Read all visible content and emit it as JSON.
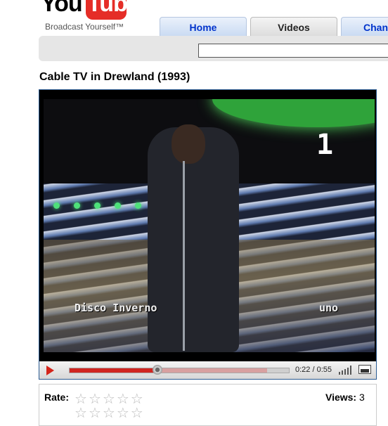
{
  "header": {
    "logo_you": "You",
    "logo_tube": "Tube",
    "tagline": "Broadcast Yourself™"
  },
  "nav": {
    "tabs": [
      {
        "label": "Home"
      },
      {
        "label": "Videos"
      },
      {
        "label": "Chann"
      }
    ]
  },
  "search": {
    "value": ""
  },
  "video": {
    "title": "Cable TV in Drewland (1993)",
    "osd_channel": "1",
    "osd_caption": "Disco Inverno",
    "osd_logo": "uno"
  },
  "player": {
    "time": "0:22 / 0:55",
    "played_fraction": 0.4,
    "loaded_fraction": 0.9
  },
  "rating": {
    "rate_label": "Rate:",
    "views_label": "Views:",
    "views_count": "3"
  },
  "colors": {
    "accent": "#d02520",
    "tab_link": "#0033cc"
  }
}
